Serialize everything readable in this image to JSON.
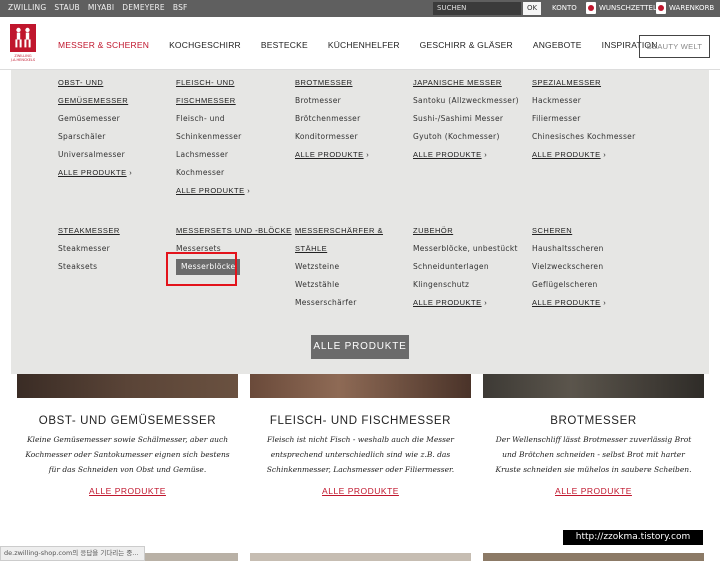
{
  "topbar": {
    "brands": [
      "ZWILLING",
      "STAUB",
      "MIYABI",
      "DEMEYERE",
      "BSF"
    ],
    "search_placeholder": "SUCHEN",
    "ok_label": "OK",
    "konto_label": "KONTO",
    "wishlist_label": "WUNSCHZETTEL",
    "wishlist_count": "0",
    "cart_label": "WARENKORB",
    "cart_count": "0"
  },
  "header": {
    "logo_text": "ZWILLING J.A.HENCKELS",
    "nav": [
      "MESSER & SCHEREN",
      "KOCHGESCHIRR",
      "BESTECKE",
      "KÜCHENHELFER",
      "GESCHIRR & GLÄSER",
      "ANGEBOTE",
      "INSPIRATION"
    ],
    "beauty_label": "BEAUTY WELT"
  },
  "mega_menu": {
    "all_label": "ALLE PRODUKTE",
    "columns_row1": [
      {
        "head": "OBST- UND GEMÜSEMESSER",
        "head_lines": [
          "OBST- UND",
          "GEMÜSEMESSER"
        ],
        "items": [
          "Gemüsemesser",
          "Sparschäler",
          "Universalmesser"
        ],
        "all": "ALLE PRODUKTE"
      },
      {
        "head": "FLEISCH- UND FISCHMESSER",
        "head_lines": [
          "FLEISCH- UND",
          "FISCHMESSER"
        ],
        "items": [
          "Fleisch- und",
          "Schinkenmesser",
          "Lachsmesser",
          "Kochmesser"
        ],
        "all": "ALLE PRODUKTE"
      },
      {
        "head": "BROTMESSER",
        "head_lines": [
          "BROTMESSER"
        ],
        "items": [
          "Brotmesser",
          "Brötchenmesser",
          "Konditormesser"
        ],
        "all": "ALLE PRODUKTE"
      },
      {
        "head": "JAPANISCHE MESSER",
        "head_lines": [
          "JAPANISCHE MESSER"
        ],
        "items": [
          "Santoku (Allzweckmesser)",
          "Sushi-/Sashimi Messer",
          "Gyutoh (Kochmesser)"
        ],
        "all": "ALLE PRODUKTE"
      },
      {
        "head": "SPEZIALMESSER",
        "head_lines": [
          "SPEZIALMESSER"
        ],
        "items": [
          "Hackmesser",
          "Filiermesser",
          "Chinesisches Kochmesser"
        ],
        "all": "ALLE PRODUKTE"
      }
    ],
    "columns_row2": [
      {
        "head_lines": [
          "STEAKMESSER"
        ],
        "items": [
          "Steakmesser",
          "Steaksets"
        ]
      },
      {
        "head_lines": [
          "MESSERSETS UND -BLÖCKE"
        ],
        "items": [
          "Messersets"
        ],
        "highlighted": "Messerblöcke"
      },
      {
        "head_lines": [
          "MESSERSCHÄRFER &",
          "STÄHLE"
        ],
        "items": [
          "Wetzsteine",
          "Wetzstähle",
          "Messerschärfer"
        ]
      },
      {
        "head_lines": [
          "ZUBEHÖR"
        ],
        "items": [
          "Messerblöcke, unbestückt",
          "Schneidunterlagen",
          "Klingenschutz"
        ],
        "all": "ALLE PRODUKTE"
      },
      {
        "head_lines": [
          "SCHEREN"
        ],
        "items": [
          "Haushaltsscheren",
          "Vielzweckscheren",
          "Geflügelscheren"
        ],
        "all": "ALLE PRODUKTE"
      }
    ],
    "button_label": "ALLE PRODUKTE"
  },
  "products": [
    {
      "title": "OBST- UND GEMÜSEMESSER",
      "desc": [
        "Kleine Gemüsemesser sowie Schälmesser, aber auch",
        "Kochmesser oder Santokumesser eignen sich bestens",
        "für das Schneiden von Obst und Gemüse."
      ],
      "link": "ALLE PRODUKTE"
    },
    {
      "title": "FLEISCH- UND FISCHMESSER",
      "desc": [
        "Fleisch ist nicht Fisch - weshalb auch die Messer",
        "entsprechend unterschiedlich sind wie z.B. das",
        "Schinkenmesser, Lachsmesser oder Filiermesser."
      ],
      "link": "ALLE PRODUKTE"
    },
    {
      "title": "BROTMESSER",
      "desc": [
        "Der Wellenschliff lässt Brotmesser zuverlässig Brot",
        "und Brötchen schneiden - selbst Brot mit harter",
        "Kruste schneiden sie mühelos in saubere Scheiben."
      ],
      "link": "ALLE PRODUKTE"
    }
  ],
  "statusbar": "de.zwilling-shop.com의 응답을 기다리는 중...",
  "watermark": "http://zzokma.tistory.com",
  "colors": {
    "accent": "#c0162d",
    "menu_bg": "#e6e6e4",
    "button_bg": "#6b6b6b",
    "highlight_box": "#e3131b"
  }
}
